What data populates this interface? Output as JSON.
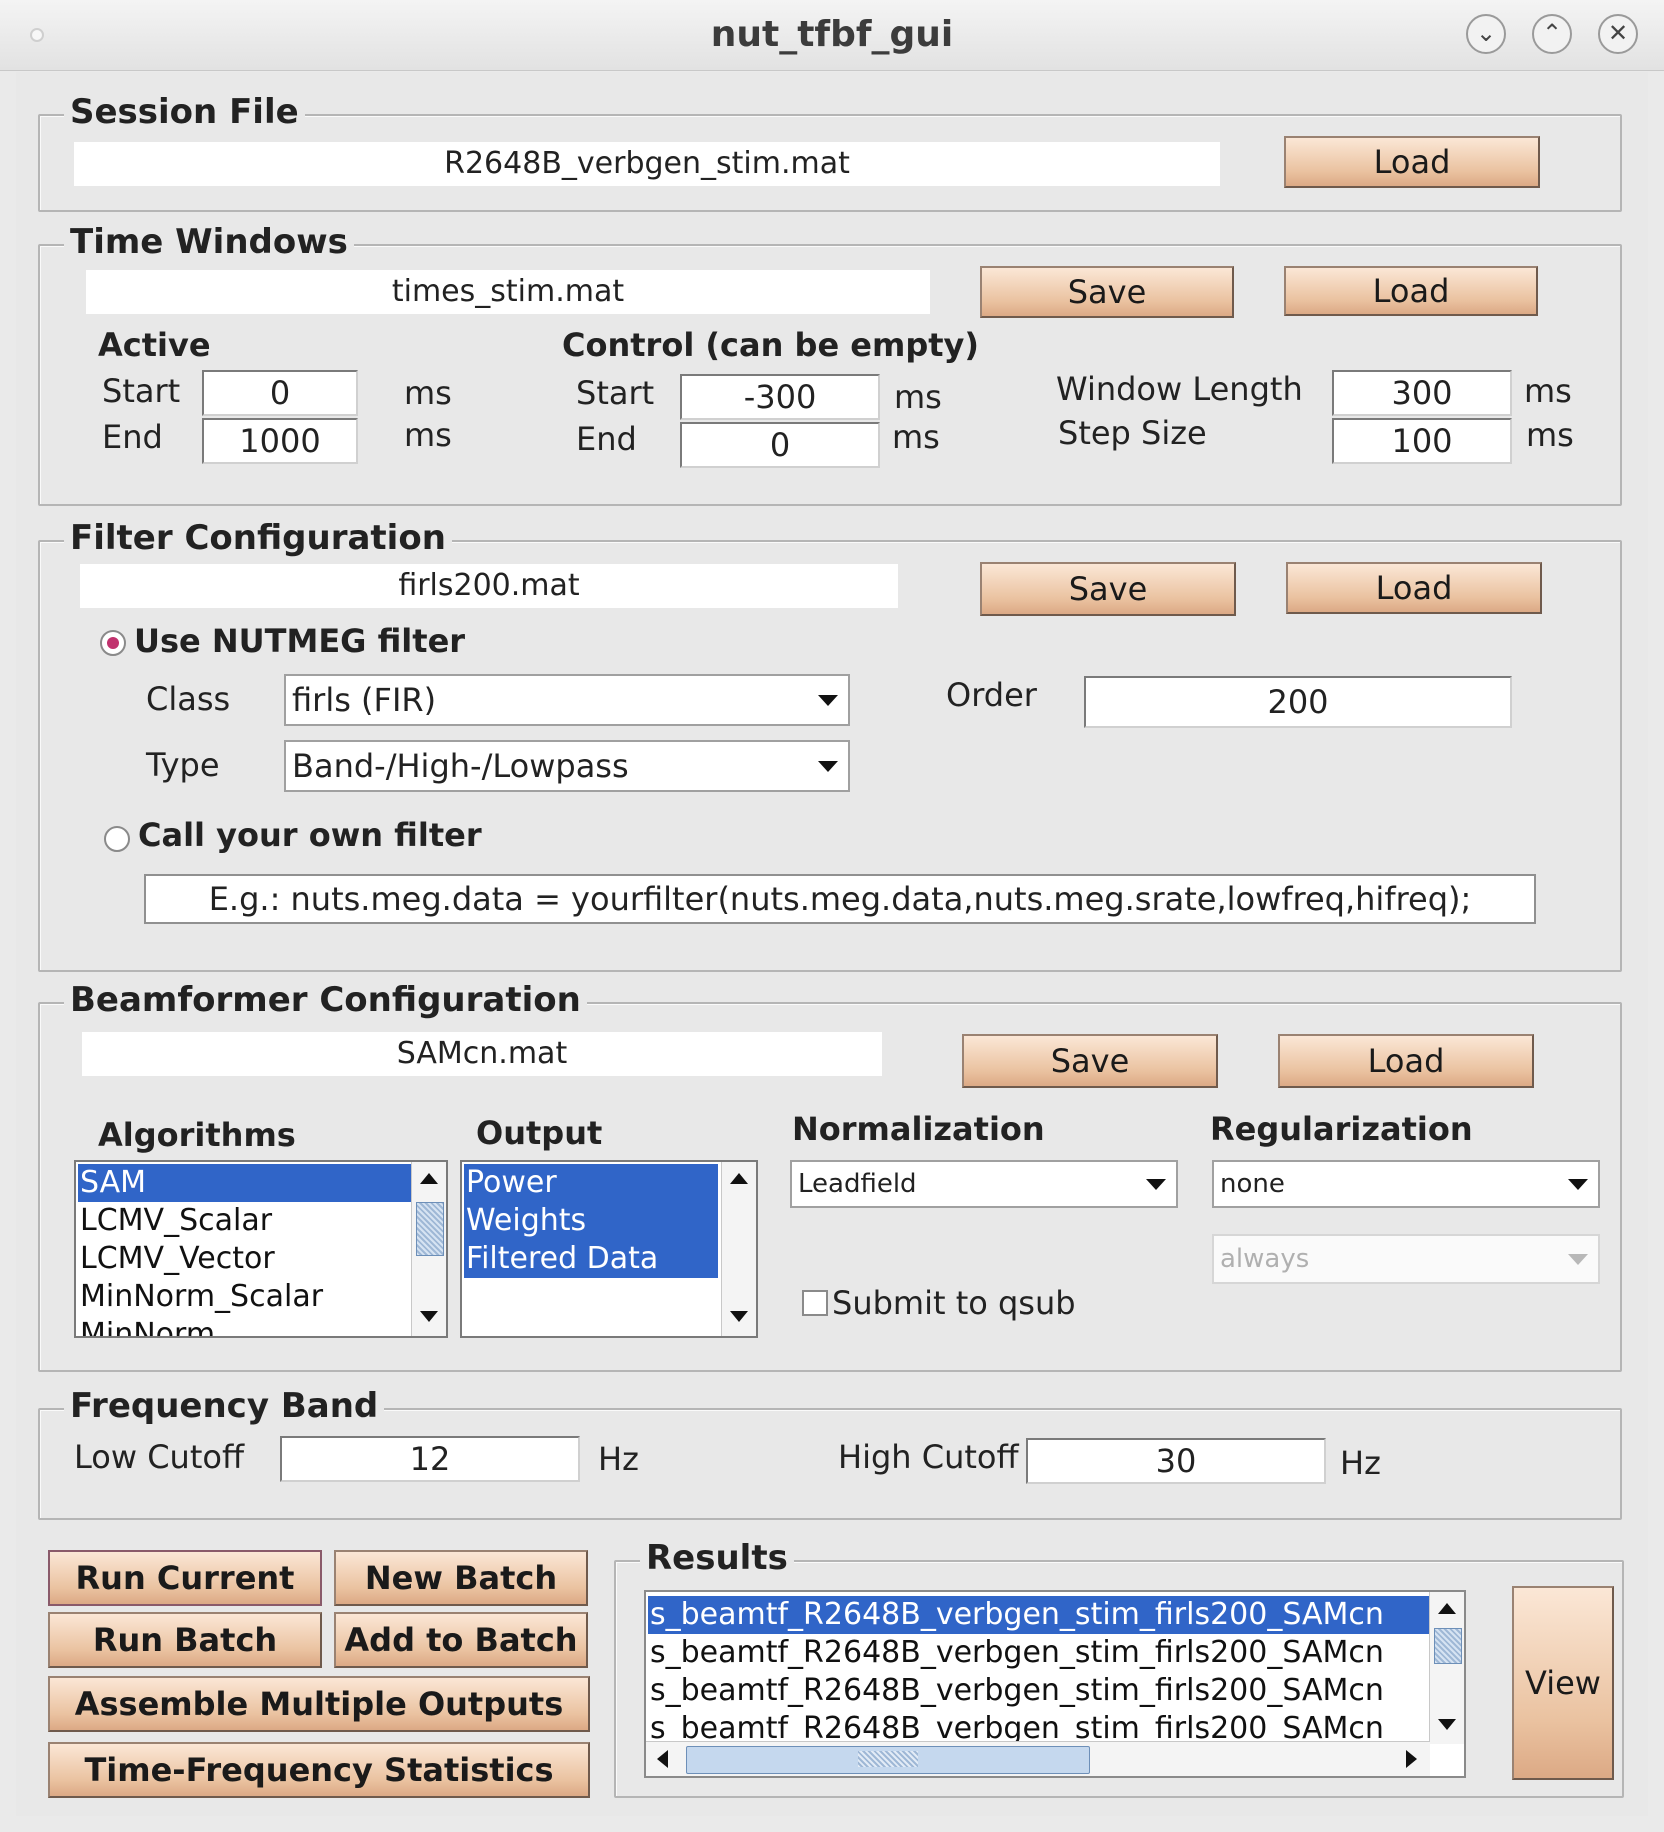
{
  "window": {
    "title": "nut_tfbf_gui",
    "controls": [
      "minimize-icon",
      "maximize-icon",
      "close-icon"
    ]
  },
  "session": {
    "title": "Session File",
    "file": "R2648B_verbgen_stim.mat",
    "load_label": "Load"
  },
  "time_windows": {
    "title": "Time Windows",
    "file": "times_stim.mat",
    "save_label": "Save",
    "load_label": "Load",
    "active_label": "Active",
    "control_label": "Control (can be empty)",
    "start_label": "Start",
    "end_label": "End",
    "unit": "ms",
    "active_start": "0",
    "active_end": "1000",
    "control_start": "-300",
    "control_end": "0",
    "window_length_label": "Window Length",
    "window_length": "300",
    "step_size_label": "Step Size",
    "step_size": "100"
  },
  "filter": {
    "title": "Filter Configuration",
    "file": "firls200.mat",
    "save_label": "Save",
    "load_label": "Load",
    "use_nutmeg_label": "Use NUTMEG filter",
    "use_nutmeg_selected": true,
    "class_label": "Class",
    "class_value": "firls (FIR)",
    "type_label": "Type",
    "type_value": "Band-/High-/Lowpass",
    "order_label": "Order",
    "order_value": "200",
    "own_filter_label": "Call your own filter",
    "own_filter_selected": false,
    "own_filter_value": "E.g.: nuts.meg.data = yourfilter(nuts.meg.data,nuts.meg.srate,lowfreq,hifreq);"
  },
  "beamformer": {
    "title": "Beamformer Configuration",
    "file": "SAMcn.mat",
    "save_label": "Save",
    "load_label": "Load",
    "algorithms_label": "Algorithms",
    "algorithms": [
      {
        "label": "SAM",
        "selected": true
      },
      {
        "label": "LCMV_Scalar",
        "selected": false
      },
      {
        "label": "LCMV_Vector",
        "selected": false
      },
      {
        "label": "MinNorm_Scalar",
        "selected": false
      },
      {
        "label": "MinNorm",
        "selected": false
      }
    ],
    "output_label": "Output",
    "outputs": [
      {
        "label": "Power",
        "selected": true
      },
      {
        "label": "Weights",
        "selected": true
      },
      {
        "label": "Filtered Data",
        "selected": true
      }
    ],
    "normalization_label": "Normalization",
    "normalization_value": "Leadfield",
    "regularization_label": "Regularization",
    "regularization_value": "none",
    "qsub_option_value": "always",
    "submit_qsub_label": "Submit to qsub",
    "submit_qsub_checked": false
  },
  "frequency": {
    "title": "Frequency Band",
    "low_label": "Low Cutoff",
    "low_value": "12",
    "high_label": "High Cutoff",
    "high_value": "30",
    "unit": "Hz"
  },
  "actions": {
    "run_current": "Run Current",
    "new_batch": "New Batch",
    "run_batch": "Run Batch",
    "add_to_batch": "Add to Batch",
    "assemble": "Assemble Multiple Outputs",
    "tf_stats": "Time-Frequency Statistics"
  },
  "results": {
    "title": "Results",
    "items": [
      {
        "label": "s_beamtf_R2648B_verbgen_stim_firls200_SAMcn",
        "selected": true
      },
      {
        "label": "s_beamtf_R2648B_verbgen_stim_firls200_SAMcn",
        "selected": false
      },
      {
        "label": "s_beamtf_R2648B_verbgen_stim_firls200_SAMcn",
        "selected": false
      },
      {
        "label": "s_beamtf_R2648B_verbgen_stim_firls200_SAMcn",
        "selected": false
      }
    ],
    "view_label": "View"
  },
  "colors": {
    "button_fill": "#eac2a0",
    "selection": "#3065c8",
    "radio_dot": "#c1326e",
    "panel_bg": "#e8e8e8"
  }
}
